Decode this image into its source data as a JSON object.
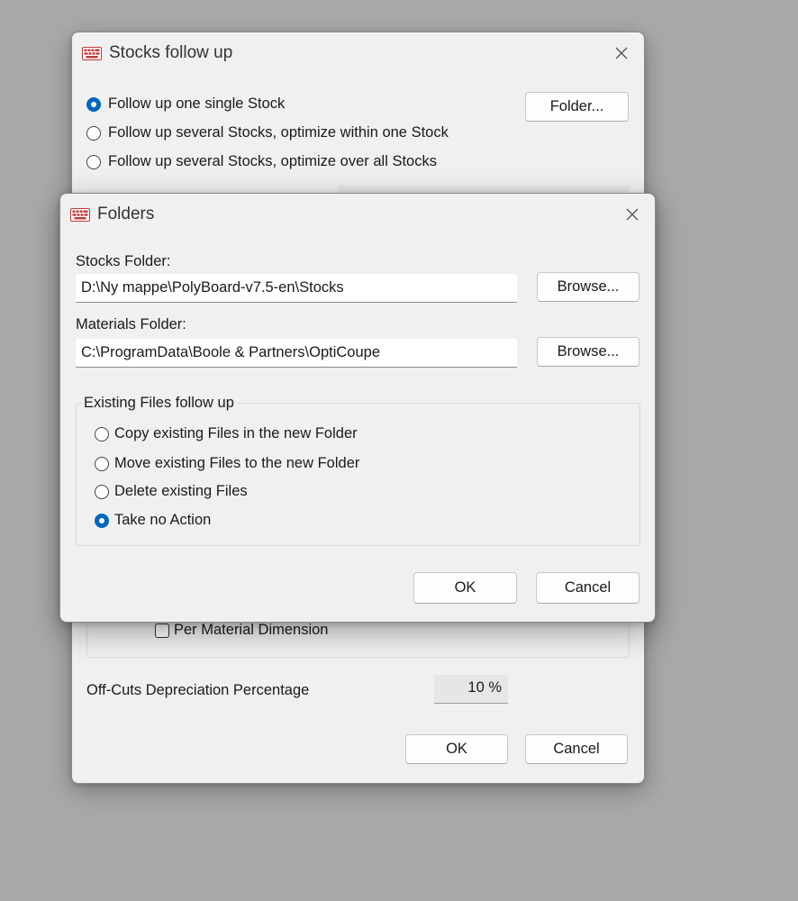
{
  "back_dialog": {
    "title": "Stocks follow up",
    "radio_options": [
      {
        "label": "Follow up one single Stock",
        "selected": true
      },
      {
        "label": "Follow up several Stocks, optimize within one Stock",
        "selected": false
      },
      {
        "label": "Follow up several Stocks, optimize over all Stocks",
        "selected": false
      }
    ],
    "folder_button": "Folder...",
    "checkbox_label": "Per Material Dimension",
    "offcuts_label": "Off-Cuts Depreciation Percentage",
    "offcuts_value": "10 %",
    "ok_button": "OK",
    "cancel_button": "Cancel"
  },
  "front_dialog": {
    "title": "Folders",
    "stocks_folder_label": "Stocks Folder:",
    "stocks_folder_value": "D:\\Ny mappe\\PolyBoard-v7.5-en\\Stocks",
    "materials_folder_label": "Materials Folder:",
    "materials_folder_value": "C:\\ProgramData\\Boole & Partners\\OptiCoupe",
    "browse_button": "Browse...",
    "group_title": "Existing Files follow up",
    "options": [
      {
        "label": "Copy existing Files in the new Folder",
        "selected": false
      },
      {
        "label": "Move existing Files to the new Folder",
        "selected": false
      },
      {
        "label": "Delete existing Files",
        "selected": false
      },
      {
        "label": "Take no Action",
        "selected": true
      }
    ],
    "ok_button": "OK",
    "cancel_button": "Cancel"
  }
}
